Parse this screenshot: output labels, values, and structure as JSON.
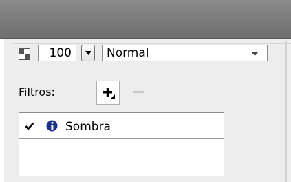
{
  "opacity": {
    "value": "100"
  },
  "blend_mode": {
    "selected": "Normal"
  },
  "filters": {
    "label": "Filtros:",
    "items": [
      {
        "name": "Sombra",
        "enabled": true
      }
    ]
  },
  "icons": {
    "opacity": "checkerboard-icon",
    "dropdown": "chevron-down-icon",
    "add": "plus-icon",
    "remove": "minus-icon",
    "check": "check-icon",
    "info": "info-icon"
  },
  "colors": {
    "titlebar": "#7d7d7d",
    "panel": "#ededed",
    "info_icon": "#1a2f8a"
  }
}
